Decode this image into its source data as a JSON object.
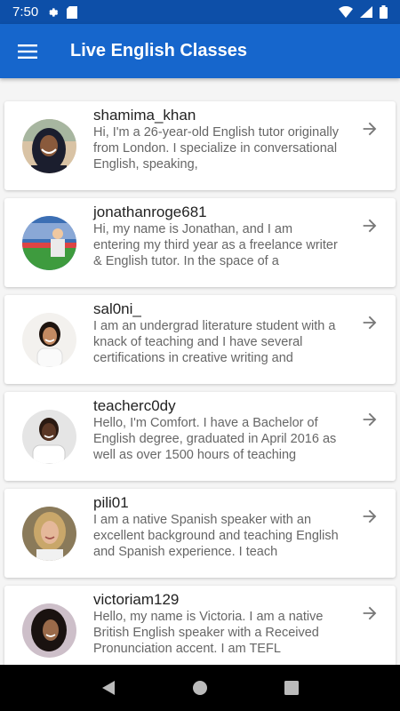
{
  "status_bar": {
    "time": "7:50",
    "icons_left": [
      "gear-icon",
      "sd-card-icon"
    ],
    "icons_right": [
      "wifi-icon",
      "signal-icon",
      "battery-icon"
    ]
  },
  "app_bar": {
    "title": "Live English Classes",
    "menu_icon": "hamburger-menu-icon",
    "color": "#1666cc"
  },
  "tutors": [
    {
      "username": "shamima_khan",
      "bio": "Hi, I'm a 26-year-old English tutor originally from London. I specialize in conversational English, speaking,",
      "avatar": "person-in-hijab-avatar"
    },
    {
      "username": "jonathanroge681",
      "bio": "Hi, my name is Jonathan, and I am entering my third year as a freelance writer & English tutor. In the space of a",
      "avatar": "person-at-stadium-avatar"
    },
    {
      "username": "sal0ni_",
      "bio": "I am an undergrad literature student with a knack of teaching and I have several certifications in creative writing and",
      "avatar": "smiling-woman-avatar"
    },
    {
      "username": "teacherc0dy",
      "bio": "Hello, I'm Comfort. I have a Bachelor of English degree, graduated in April 2016 as well as over 1500 hours of teaching",
      "avatar": "smiling-woman-white-shirt-avatar"
    },
    {
      "username": "pili01",
      "bio": "I am a native Spanish speaker with an excellent background and teaching English and Spanish experience. I teach",
      "avatar": "blonde-woman-avatar"
    },
    {
      "username": "victoriam129",
      "bio": "Hello, my name is Victoria. I am a native British English speaker with a Received Pronunciation accent. I am TEFL",
      "avatar": "curly-hair-woman-avatar"
    }
  ],
  "nav_bar": {
    "buttons": [
      "back-icon",
      "home-icon",
      "recents-icon"
    ]
  }
}
